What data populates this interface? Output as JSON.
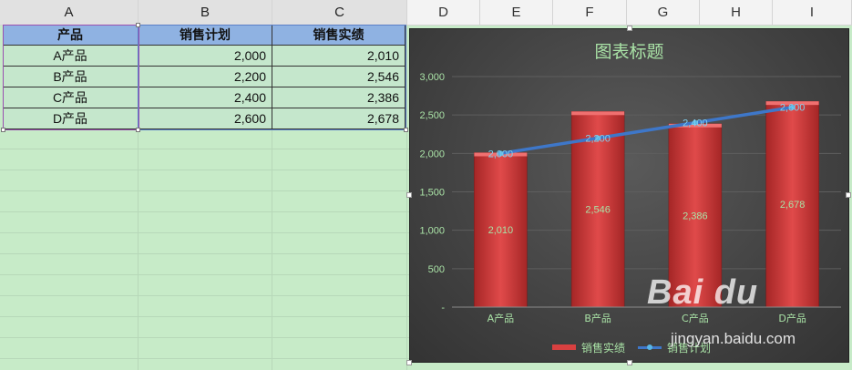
{
  "columns": [
    "A",
    "B",
    "C",
    "D",
    "E",
    "F",
    "G",
    "H",
    "I"
  ],
  "table": {
    "headers": [
      "产品",
      "销售计划",
      "销售实绩"
    ],
    "rows": [
      [
        "A产品",
        "2,000",
        "2,010"
      ],
      [
        "B产品",
        "2,200",
        "2,546"
      ],
      [
        "C产品",
        "2,400",
        "2,386"
      ],
      [
        "D产品",
        "2,600",
        "2,678"
      ]
    ]
  },
  "chart_data": {
    "type": "bar",
    "title": "图表标题",
    "categories": [
      "A产品",
      "B产品",
      "C产品",
      "D产品"
    ],
    "ylim": [
      0,
      3000
    ],
    "yticks": [
      "-",
      "500",
      "1,000",
      "1,500",
      "2,000",
      "2,500",
      "3,000"
    ],
    "ytick_values": [
      0,
      500,
      1000,
      1500,
      2000,
      2500,
      3000
    ],
    "grid": true,
    "legend_position": "bottom",
    "series": [
      {
        "name": "销售实绩",
        "kind": "bar",
        "color": "#d94040",
        "values": [
          2010,
          2546,
          2386,
          2678
        ],
        "labels": [
          "2,010",
          "2,546",
          "2,386",
          "2,678"
        ]
      },
      {
        "name": "销售计划",
        "kind": "line",
        "color": "#3e77c9",
        "values": [
          2000,
          2200,
          2400,
          2600
        ],
        "labels": [
          "2,000",
          "2,200",
          "2,400",
          "2,600"
        ]
      }
    ]
  },
  "watermark": {
    "logo": "Bai du",
    "url": "jingyan.baidu.com"
  }
}
